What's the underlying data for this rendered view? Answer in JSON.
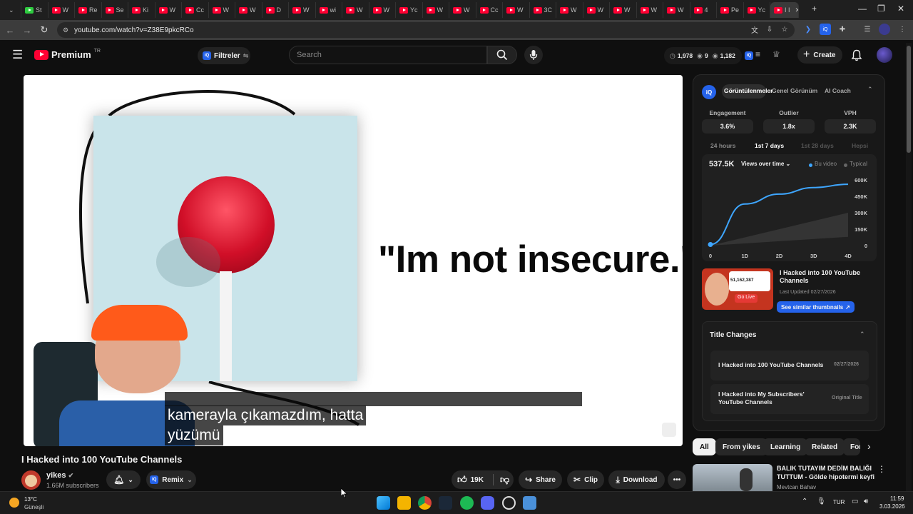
{
  "browser": {
    "tabs": [
      "St",
      "W",
      "Re",
      "Se",
      "Ki",
      "W",
      "Cc",
      "W",
      "W",
      "D",
      "W",
      "wi",
      "W",
      "W",
      "Yc",
      "W",
      "W",
      "Cc",
      "W",
      "3C",
      "W",
      "W",
      "W",
      "W",
      "W",
      "4",
      "Pe",
      "Yc",
      "I I"
    ],
    "url": "youtube.com/watch?v=Z38E9pkcRCo"
  },
  "youtube": {
    "logo_text": "Premium",
    "region": "TR",
    "filters_label": "Filtreler",
    "search_placeholder": "Search",
    "stats": {
      "views": "1,978",
      "videos": "9",
      "subs": "1,182"
    },
    "create_label": "Create"
  },
  "video": {
    "overlay_text": "\"Im not insecure.\"",
    "subtitle_line1": "kamerayla çıkamazdım, hatta",
    "subtitle_line2": "yüzümü"
  },
  "meta": {
    "title": "I Hacked into 100 YouTube Channels",
    "channel": "yikes",
    "subscribers": "1.66M subscribers",
    "remix": "Remix",
    "likes": "19K",
    "share": "Share",
    "clip": "Clip",
    "download": "Download"
  },
  "panel": {
    "tabs": [
      "Görüntülenmeler",
      "Genel Görünüm",
      "AI Coach"
    ],
    "metrics": [
      {
        "label": "Engagement",
        "value": "3.6%"
      },
      {
        "label": "Outlier",
        "value": "1.8x"
      },
      {
        "label": "VPH",
        "value": "2.3K"
      }
    ],
    "periods": [
      "24 hours",
      "1st 7 days",
      "1st 28 days",
      "Hepsi"
    ],
    "chart_views": "537.5K",
    "chart_dropdown": "Views over time",
    "legend_video": "Bu video",
    "legend_typical": "Typical",
    "y_ticks": [
      "600K",
      "450K",
      "300K",
      "150K",
      "0"
    ],
    "x_ticks": [
      "0",
      "1D",
      "2D",
      "3D",
      "4D"
    ],
    "thumb_title": "I Hacked into 100 YouTube Channels",
    "thumb_updated": "Last Updated 02/27/2026",
    "thumb_count": "51,162,387",
    "thumb_live": "Go Live",
    "similar_label": "See similar thumbnails",
    "title_changes_header": "Title Changes",
    "title_changes": [
      {
        "title": "I Hacked into 100 YouTube Channels",
        "tag": "02/27/2026"
      },
      {
        "title": "I Hacked into My Subscribers' YouTube Channels",
        "tag": "Original Title"
      }
    ]
  },
  "chips": [
    "All",
    "From yikes",
    "Learning",
    "Related",
    "For"
  ],
  "reco": {
    "title_line1": "BALIK TUTAYIM DEDİM BALIĞI",
    "title_line2": "TUTTUM - Gölde hipotermi keyfi",
    "channel": "Mevtcan Bahav"
  },
  "taskbar": {
    "temp": "13°C",
    "weather": "Güneşli",
    "lang": "TUR",
    "time": "11:59",
    "date": "3.03.2026"
  },
  "chart_data": {
    "type": "line",
    "x": [
      "0",
      "1D",
      "2D",
      "3D",
      "4D"
    ],
    "series": [
      {
        "name": "Bu video",
        "values": [
          10000,
          380000,
          470000,
          530000,
          560000
        ]
      }
    ],
    "ylim": [
      0,
      600000
    ]
  }
}
